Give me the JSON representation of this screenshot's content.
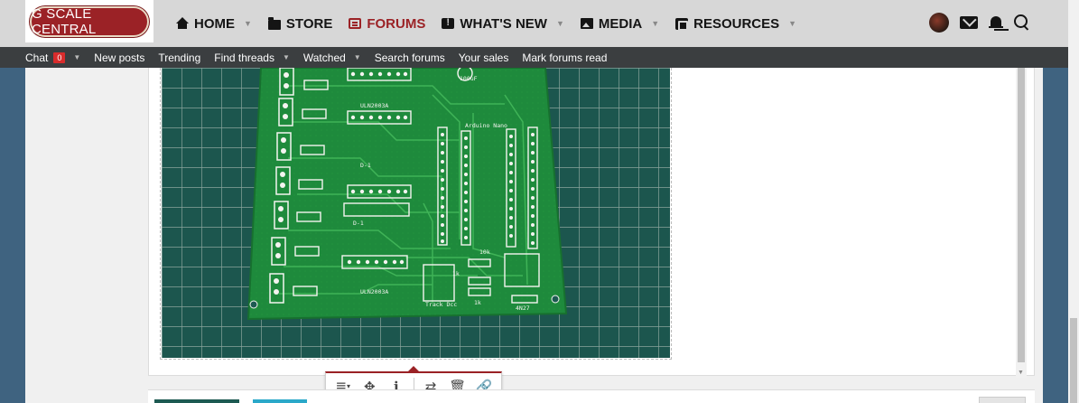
{
  "header": {
    "logo_text": "G SCALE CENTRAL",
    "nav": [
      {
        "label": "HOME",
        "icon": "home-icon",
        "has_dropdown": true
      },
      {
        "label": "STORE",
        "icon": "folder-icon",
        "has_dropdown": false
      },
      {
        "label": "FORUMS",
        "icon": "forum-icon",
        "has_dropdown": false,
        "active": true
      },
      {
        "label": "WHAT'S NEW",
        "icon": "whats-new-icon",
        "has_dropdown": true
      },
      {
        "label": "MEDIA",
        "icon": "image-icon",
        "has_dropdown": true
      },
      {
        "label": "RESOURCES",
        "icon": "resources-icon",
        "has_dropdown": true
      }
    ],
    "user_icons": [
      "avatar",
      "envelope-icon",
      "bell-icon",
      "search-icon"
    ]
  },
  "subnav": {
    "chat_label": "Chat",
    "chat_count": "0",
    "items": [
      {
        "label": "New posts"
      },
      {
        "label": "Trending"
      },
      {
        "label": "Find threads",
        "has_dropdown": true
      },
      {
        "label": "Watched",
        "has_dropdown": true
      },
      {
        "label": "Search forums"
      },
      {
        "label": "Your sales"
      },
      {
        "label": "Mark forums read"
      }
    ]
  },
  "pcb": {
    "labels": {
      "arduino": "Arduino Nano",
      "cap": "100uF",
      "track": "Track Dcc",
      "chip": "ULN2003A",
      "r10k": "10k",
      "r1k": "1k",
      "r1k2": "1k",
      "hw": "4N27",
      "ic": "ULN2003A",
      "d1": "D-1",
      "d2": "D-1"
    }
  },
  "image_toolbar": {
    "buttons": [
      "align-icon",
      "move-icon",
      "alt-text-icon",
      "replace-icon",
      "delete-icon",
      "link-icon"
    ]
  },
  "colors": {
    "brand": "#9b2226",
    "topbar": "#d7d7d7",
    "subnav": "#3b3e40",
    "background": "#3f6380",
    "pcb": "#1e8a3c"
  }
}
